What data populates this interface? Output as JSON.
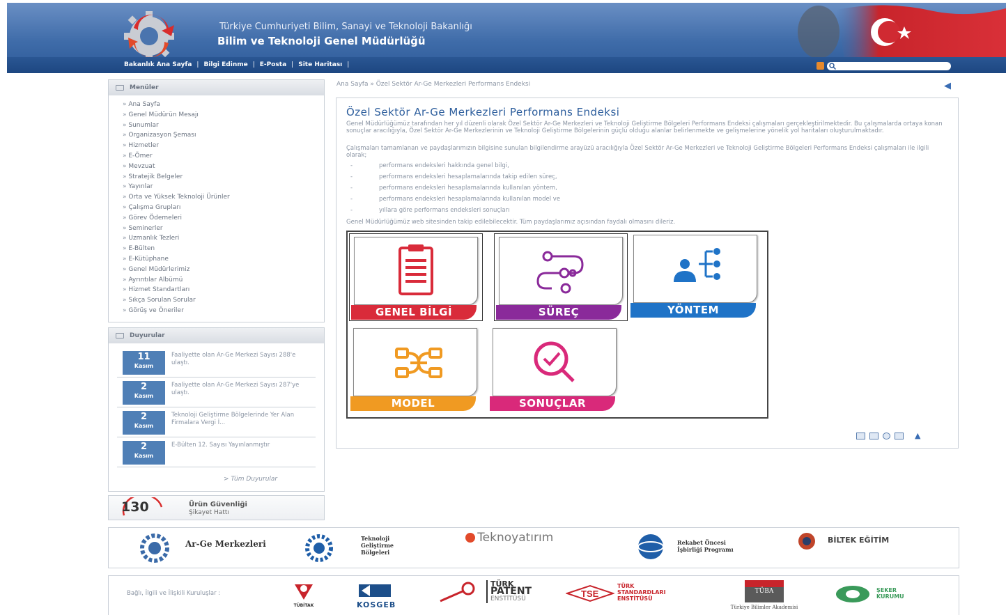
{
  "header": {
    "title_line1": "Türkiye Cumhuriyeti Bilim, Sanayi ve Teknoloji Bakanlığı",
    "title_line2": "Bilim ve Teknoloji Genel Müdürlüğü",
    "nav": [
      "Bakanlık Ana Sayfa",
      "Bilgi Edinme",
      "E-Posta",
      "Site Haritası"
    ],
    "search_placeholder": ""
  },
  "menu": {
    "title": "Menüler",
    "items": [
      "Ana Sayfa",
      "Genel Müdürün Mesajı",
      "Sunumlar",
      "Organizasyon Şeması",
      "Hizmetler",
      "E-Ömer",
      "Mevzuat",
      "Stratejik Belgeler",
      "Yayınlar",
      "Orta ve Yüksek Teknoloji Ürünler",
      "Çalışma Grupları",
      "Görev Ödemeleri",
      "Seminerler",
      "Uzmanlık Tezleri",
      "E-Bülten",
      "E-Kütüphane",
      "Genel Müdürlerimiz",
      "Ayrıntılar Albümü",
      "Hizmet Standartları",
      "Sıkça Sorulan Sorular",
      "Görüş ve Öneriler"
    ]
  },
  "announcements": {
    "title": "Duyurular",
    "items": [
      {
        "day": "11",
        "month": "Kasım",
        "text": "Faaliyette olan Ar-Ge Merkezi Sayısı 288'e ulaştı."
      },
      {
        "day": "2",
        "month": "Kasım",
        "text": "Faaliyette olan Ar-Ge Merkezi Sayısı 287'ye ulaştı."
      },
      {
        "day": "2",
        "month": "Kasım",
        "text": "Teknoloji Geliştirme Bölgelerinde Yer Alan Firmalara Vergi İ..."
      },
      {
        "day": "2",
        "month": "Kasım",
        "text": "E-Bülten 12. Sayısı Yayınlanmıştır"
      }
    ],
    "all_link": "> Tüm Duyurular"
  },
  "hotline": {
    "number": "130",
    "line1": "Ürün Güvenliği",
    "line2": "Şikayet Hattı"
  },
  "breadcrumb": "Ana Sayfa » Özel Sektör Ar-Ge Merkezleri Performans Endeksi",
  "main": {
    "title": "Özel Sektör Ar-Ge Merkezleri Performans Endeksi",
    "para1": "Genel Müdürlüğümüz tarafından her yıl düzenli olarak Özel Sektör Ar-Ge Merkezleri ve Teknoloji Geliştirme Bölgeleri Performans Endeksi çalışmaları gerçekleştirilmektedir. Bu çalışmalarda ortaya konan sonuçlar aracılığıyla, Özel Sektör Ar-Ge Merkezlerinin ve Teknoloji Geliştirme Bölgelerinin güçlü olduğu alanlar belirlenmekte ve gelişmelerine yönelik yol haritaları oluşturulmaktadır.",
    "para2": "Çalışmaları tamamlanan ve paydaşlarımızın bilgisine sunulan bilgilendirme arayüzü aracılığıyla Özel Sektör Ar-Ge Merkezleri ve Teknoloji Geliştirme Bölgeleri Performans Endeksi çalışmaları ile ilgili olarak;",
    "bullets": [
      "performans endeksleri hakkında genel bilgi,",
      "performans endeksleri hesaplamalarında takip edilen süreç,",
      "performans endeksleri hesaplamalarında kullanılan yöntem,",
      "performans endeksleri hesaplamalarında kullanılan model ve",
      "yıllara göre performans endeksleri sonuçları"
    ],
    "para3": "Genel Müdürlüğümüz web sitesinden takip edilebilecektir. Tüm paydaşlarımız açısından faydalı olmasını dileriz.",
    "tiles": [
      {
        "label": "GENEL BİLGİ",
        "color": "#d92b3a",
        "icon": "clipboard-icon"
      },
      {
        "label": "SÜREÇ",
        "color": "#8a2a9a",
        "icon": "process-icon"
      },
      {
        "label": "YÖNTEM",
        "color": "#1f73c7",
        "icon": "hierarchy-icon"
      },
      {
        "label": "MODEL",
        "color": "#f09a22",
        "icon": "model-icon"
      },
      {
        "label": "SONUÇLAR",
        "color": "#d9297a",
        "icon": "results-icon"
      }
    ]
  },
  "logos1": {
    "arge": "Ar-Ge Merkezleri",
    "tgb": [
      "Teknoloji",
      "Geliştirme",
      "Bölgeleri"
    ],
    "teknoyatirim": "Teknoyatırım",
    "rekabet": [
      "Rekabet Öncesi",
      "İşbirliği Programı"
    ],
    "biltek": "BİLTEK EĞİTİM"
  },
  "logos2": {
    "label": "Bağlı, İlgili ve İlişkili Kuruluşlar :",
    "tubitak": "TÜBİTAK",
    "kosgeb": "KOSGEB",
    "patent": [
      "TÜRK",
      "PATENT",
      "ENSTİTÜSÜ"
    ],
    "tse_mark": "TSE",
    "tse": [
      "TÜRK",
      "STANDARDLARI",
      "ENSTİTÜSÜ"
    ],
    "tuba": "TÜBA",
    "tuba_sub": "Türkiye Bilimler Akademisi",
    "seker": [
      "ŞEKER",
      "KURUMU"
    ]
  },
  "colors": {
    "header_blue": "#3f6ca9",
    "link_blue": "#2c5d9c"
  }
}
